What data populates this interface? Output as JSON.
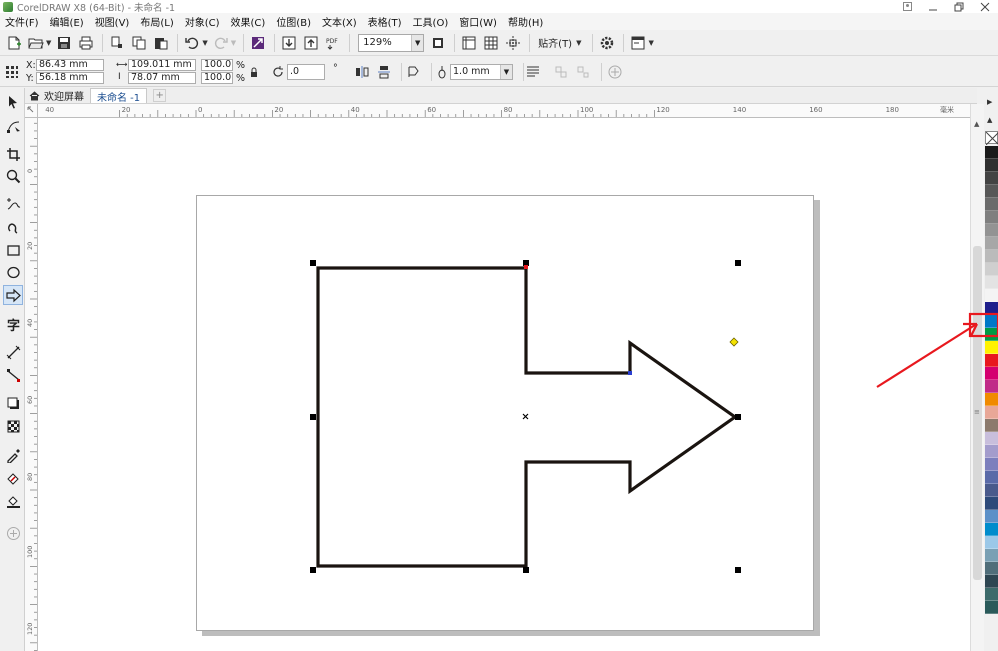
{
  "window": {
    "title": "CorelDRAW X8 (64-Bit) - 未命名 -1",
    "controls": [
      "minimize-icon",
      "restore-icon",
      "close-icon"
    ]
  },
  "menu": {
    "items": [
      "文件(F)",
      "编辑(E)",
      "视图(V)",
      "布局(L)",
      "对象(C)",
      "效果(C)",
      "位图(B)",
      "文本(X)",
      "表格(T)",
      "工具(O)",
      "窗口(W)",
      "帮助(H)"
    ]
  },
  "toolbar": {
    "zoom_value": "129%",
    "snap_label": "贴齐(T)",
    "icons": [
      "new-document-icon",
      "open-icon",
      "save-icon",
      "print-icon",
      "cut-icon",
      "copy-icon",
      "paste-icon",
      "undo-icon",
      "redo-icon",
      "corel-connect-icon",
      "import-icon",
      "export-icon",
      "publish-pdf-icon",
      "full-screen-icon",
      "show-rulers-icon",
      "show-grid-icon",
      "show-guidelines-icon",
      "options-gear-icon",
      "application-launcher-icon"
    ]
  },
  "properties": {
    "x_label": "X:",
    "x_value": "86.43 mm",
    "y_label": "Y:",
    "y_value": "56.18 mm",
    "width_value": "109.011 mm",
    "height_value": "78.07 mm",
    "scale_x": "100.0",
    "scale_y": "100.0",
    "percent": "%",
    "rotation": ".0",
    "degree": "°",
    "outline_width": "1.0 mm"
  },
  "tabs": {
    "welcome": "欢迎屏幕",
    "document": "未命名 -1"
  },
  "ruler": {
    "h_ticks": [
      "40",
      "20",
      "0",
      "20",
      "40",
      "60",
      "80",
      "100",
      "120",
      "140",
      "160",
      "180"
    ],
    "h_unit": "毫米",
    "v_ticks": [
      "0",
      "20",
      "40",
      "60",
      "80",
      "100",
      "120",
      "140"
    ]
  },
  "colors": {
    "outline": "#1a1410",
    "selected_swatch": "#009a44",
    "annotation": "#e8181e",
    "palette": [
      "#1a1a1a",
      "#2f2f2f",
      "#434343",
      "#575757",
      "#6b6b6b",
      "#7f7f7f",
      "#939393",
      "#a7a7a7",
      "#bbbbbb",
      "#cfcfcf",
      "#e3e3e3",
      "#f4f4f4",
      "#1e1f8c",
      "#0078c8",
      "#009a44",
      "#fff200",
      "#e8181e",
      "#d4006f",
      "#c02a88",
      "#f08a00",
      "#e8a797",
      "#8c7a6d",
      "#c8bedc",
      "#a39ccc",
      "#7c7fbd",
      "#5a6aa8",
      "#4a5a8c",
      "#2e4a7a",
      "#5c90c8",
      "#008ccc",
      "#9bc8e8",
      "#7aa0b4",
      "#506e7a",
      "#2e4652",
      "#3d6b6b",
      "#2a5a5a"
    ]
  }
}
